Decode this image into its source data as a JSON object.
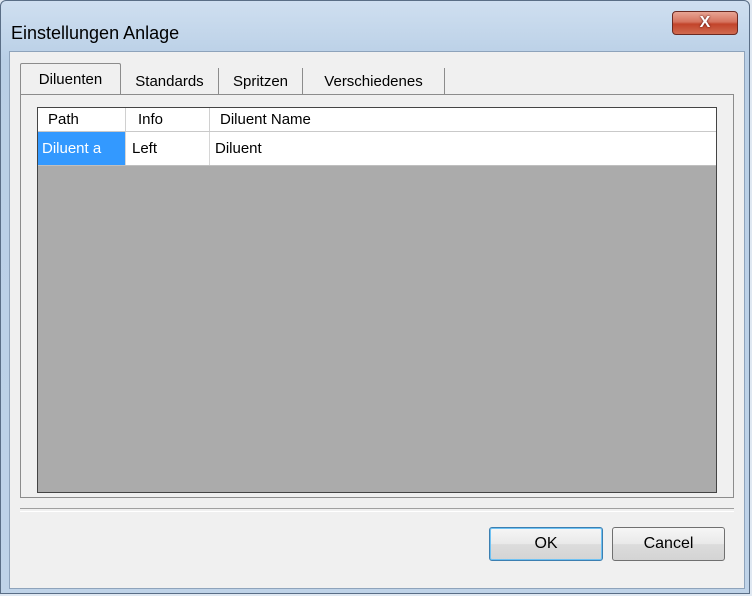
{
  "window": {
    "title": "Einstellungen Anlage",
    "close_glyph": "X"
  },
  "tabs": [
    {
      "label": "Diluenten",
      "active": true
    },
    {
      "label": "Standards",
      "active": false
    },
    {
      "label": "Spritzen",
      "active": false
    },
    {
      "label": "Verschiedenes",
      "active": false
    }
  ],
  "grid": {
    "columns": [
      "Path",
      "Info",
      "Diluent Name"
    ],
    "rows": [
      {
        "path": "Diluent a",
        "info": "Left",
        "name": "Diluent"
      }
    ]
  },
  "buttons": {
    "ok": "OK",
    "cancel": "Cancel"
  },
  "colors": {
    "selection": "#3399ff",
    "grid_empty": "#ababab",
    "close": "#c2442b"
  },
  "icons": {
    "close": "close-icon"
  }
}
